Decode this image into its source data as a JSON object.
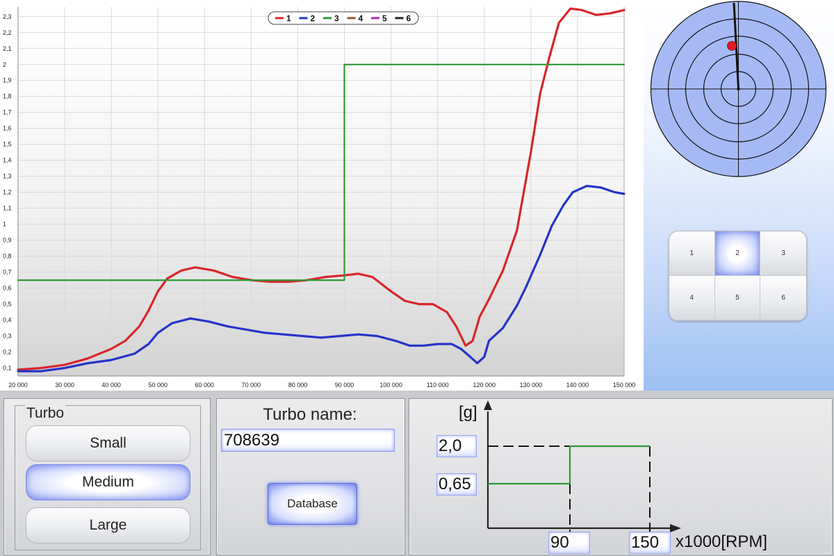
{
  "chart_data": {
    "type": "line",
    "title": "",
    "xlabel": "",
    "ylabel": "",
    "xlim": [
      20000,
      150000
    ],
    "ylim": [
      0.05,
      2.36
    ],
    "x_ticks": [
      "20 000",
      "30 000",
      "40 000",
      "50 000",
      "60 000",
      "70 000",
      "80 000",
      "90 000",
      "100 000",
      "110 000",
      "120 000",
      "130 000",
      "140 000",
      "150 000"
    ],
    "y_ticks": [
      "0,1",
      "0,2",
      "0,3",
      "0,4",
      "0,5",
      "0,6",
      "0,7",
      "0,8",
      "0,9",
      "1",
      "1,1",
      "1,2",
      "1,3",
      "1,4",
      "1,5",
      "1,6",
      "1,7",
      "1,8",
      "1,9",
      "2",
      "2,1",
      "2,2",
      "2,3"
    ],
    "grid": true,
    "legend_position": "top-center",
    "series": [
      {
        "name": "1",
        "color": "#d8262a",
        "points": [
          [
            20000,
            0.09
          ],
          [
            25000,
            0.1
          ],
          [
            30000,
            0.12
          ],
          [
            35000,
            0.16
          ],
          [
            40000,
            0.22
          ],
          [
            43000,
            0.27
          ],
          [
            46000,
            0.36
          ],
          [
            48000,
            0.46
          ],
          [
            50000,
            0.58
          ],
          [
            52000,
            0.66
          ],
          [
            55000,
            0.71
          ],
          [
            58000,
            0.73
          ],
          [
            62000,
            0.71
          ],
          [
            66000,
            0.67
          ],
          [
            70000,
            0.65
          ],
          [
            74000,
            0.64
          ],
          [
            78000,
            0.64
          ],
          [
            82000,
            0.65
          ],
          [
            86000,
            0.67
          ],
          [
            90000,
            0.68
          ],
          [
            93000,
            0.69
          ],
          [
            96000,
            0.67
          ],
          [
            100000,
            0.58
          ],
          [
            103000,
            0.52
          ],
          [
            106000,
            0.5
          ],
          [
            109000,
            0.5
          ],
          [
            112000,
            0.45
          ],
          [
            114000,
            0.36
          ],
          [
            116000,
            0.24
          ],
          [
            117500,
            0.27
          ],
          [
            119000,
            0.42
          ],
          [
            121000,
            0.53
          ],
          [
            124000,
            0.71
          ],
          [
            127000,
            0.96
          ],
          [
            130000,
            1.45
          ],
          [
            132000,
            1.82
          ],
          [
            134000,
            2.05
          ],
          [
            136000,
            2.26
          ],
          [
            138500,
            2.35
          ],
          [
            141000,
            2.34
          ],
          [
            144000,
            2.31
          ],
          [
            147000,
            2.32
          ],
          [
            150000,
            2.34
          ]
        ]
      },
      {
        "name": "2",
        "color": "#2533c8",
        "points": [
          [
            20000,
            0.08
          ],
          [
            25000,
            0.08
          ],
          [
            30000,
            0.1
          ],
          [
            35000,
            0.13
          ],
          [
            40000,
            0.15
          ],
          [
            45000,
            0.19
          ],
          [
            48000,
            0.25
          ],
          [
            50000,
            0.32
          ],
          [
            53000,
            0.38
          ],
          [
            57000,
            0.41
          ],
          [
            61000,
            0.39
          ],
          [
            65000,
            0.36
          ],
          [
            69000,
            0.34
          ],
          [
            73000,
            0.32
          ],
          [
            77000,
            0.31
          ],
          [
            81000,
            0.3
          ],
          [
            85000,
            0.29
          ],
          [
            89000,
            0.3
          ],
          [
            93000,
            0.31
          ],
          [
            97000,
            0.3
          ],
          [
            101000,
            0.27
          ],
          [
            104000,
            0.24
          ],
          [
            107000,
            0.24
          ],
          [
            110000,
            0.25
          ],
          [
            113000,
            0.25
          ],
          [
            115000,
            0.22
          ],
          [
            117000,
            0.17
          ],
          [
            118500,
            0.13
          ],
          [
            120000,
            0.17
          ],
          [
            121000,
            0.27
          ],
          [
            124000,
            0.35
          ],
          [
            127000,
            0.49
          ],
          [
            129000,
            0.61
          ],
          [
            132000,
            0.81
          ],
          [
            134500,
            0.99
          ],
          [
            137000,
            1.12
          ],
          [
            139000,
            1.2
          ],
          [
            142000,
            1.24
          ],
          [
            145000,
            1.23
          ],
          [
            148000,
            1.2
          ],
          [
            150000,
            1.19
          ]
        ]
      },
      {
        "name": "3",
        "color": "#2e9a33",
        "points": [
          [
            20000,
            0.65
          ],
          [
            90000,
            0.65
          ],
          [
            90000,
            2.0
          ],
          [
            150000,
            2.0
          ]
        ]
      },
      {
        "name": "4",
        "color": "#8b5a3a",
        "points": []
      },
      {
        "name": "5",
        "color": "#b52ab5",
        "points": []
      },
      {
        "name": "6",
        "color": "#222222",
        "points": []
      }
    ]
  },
  "keypad": {
    "keys": [
      "1",
      "2",
      "3",
      "4",
      "5",
      "6"
    ],
    "selected": "2"
  },
  "turbo_group": {
    "title": "Turbo",
    "options": [
      "Small",
      "Medium",
      "Large"
    ],
    "selected": "Medium"
  },
  "turbo_name": {
    "label": "Turbo name:",
    "value": "708639",
    "button": "Database"
  },
  "profile_graph": {
    "y_unit": "[g]",
    "y_values": [
      "2,0",
      "0,65"
    ],
    "x_values": [
      "90",
      "150"
    ],
    "x_unit": "x1000[RPM]"
  }
}
